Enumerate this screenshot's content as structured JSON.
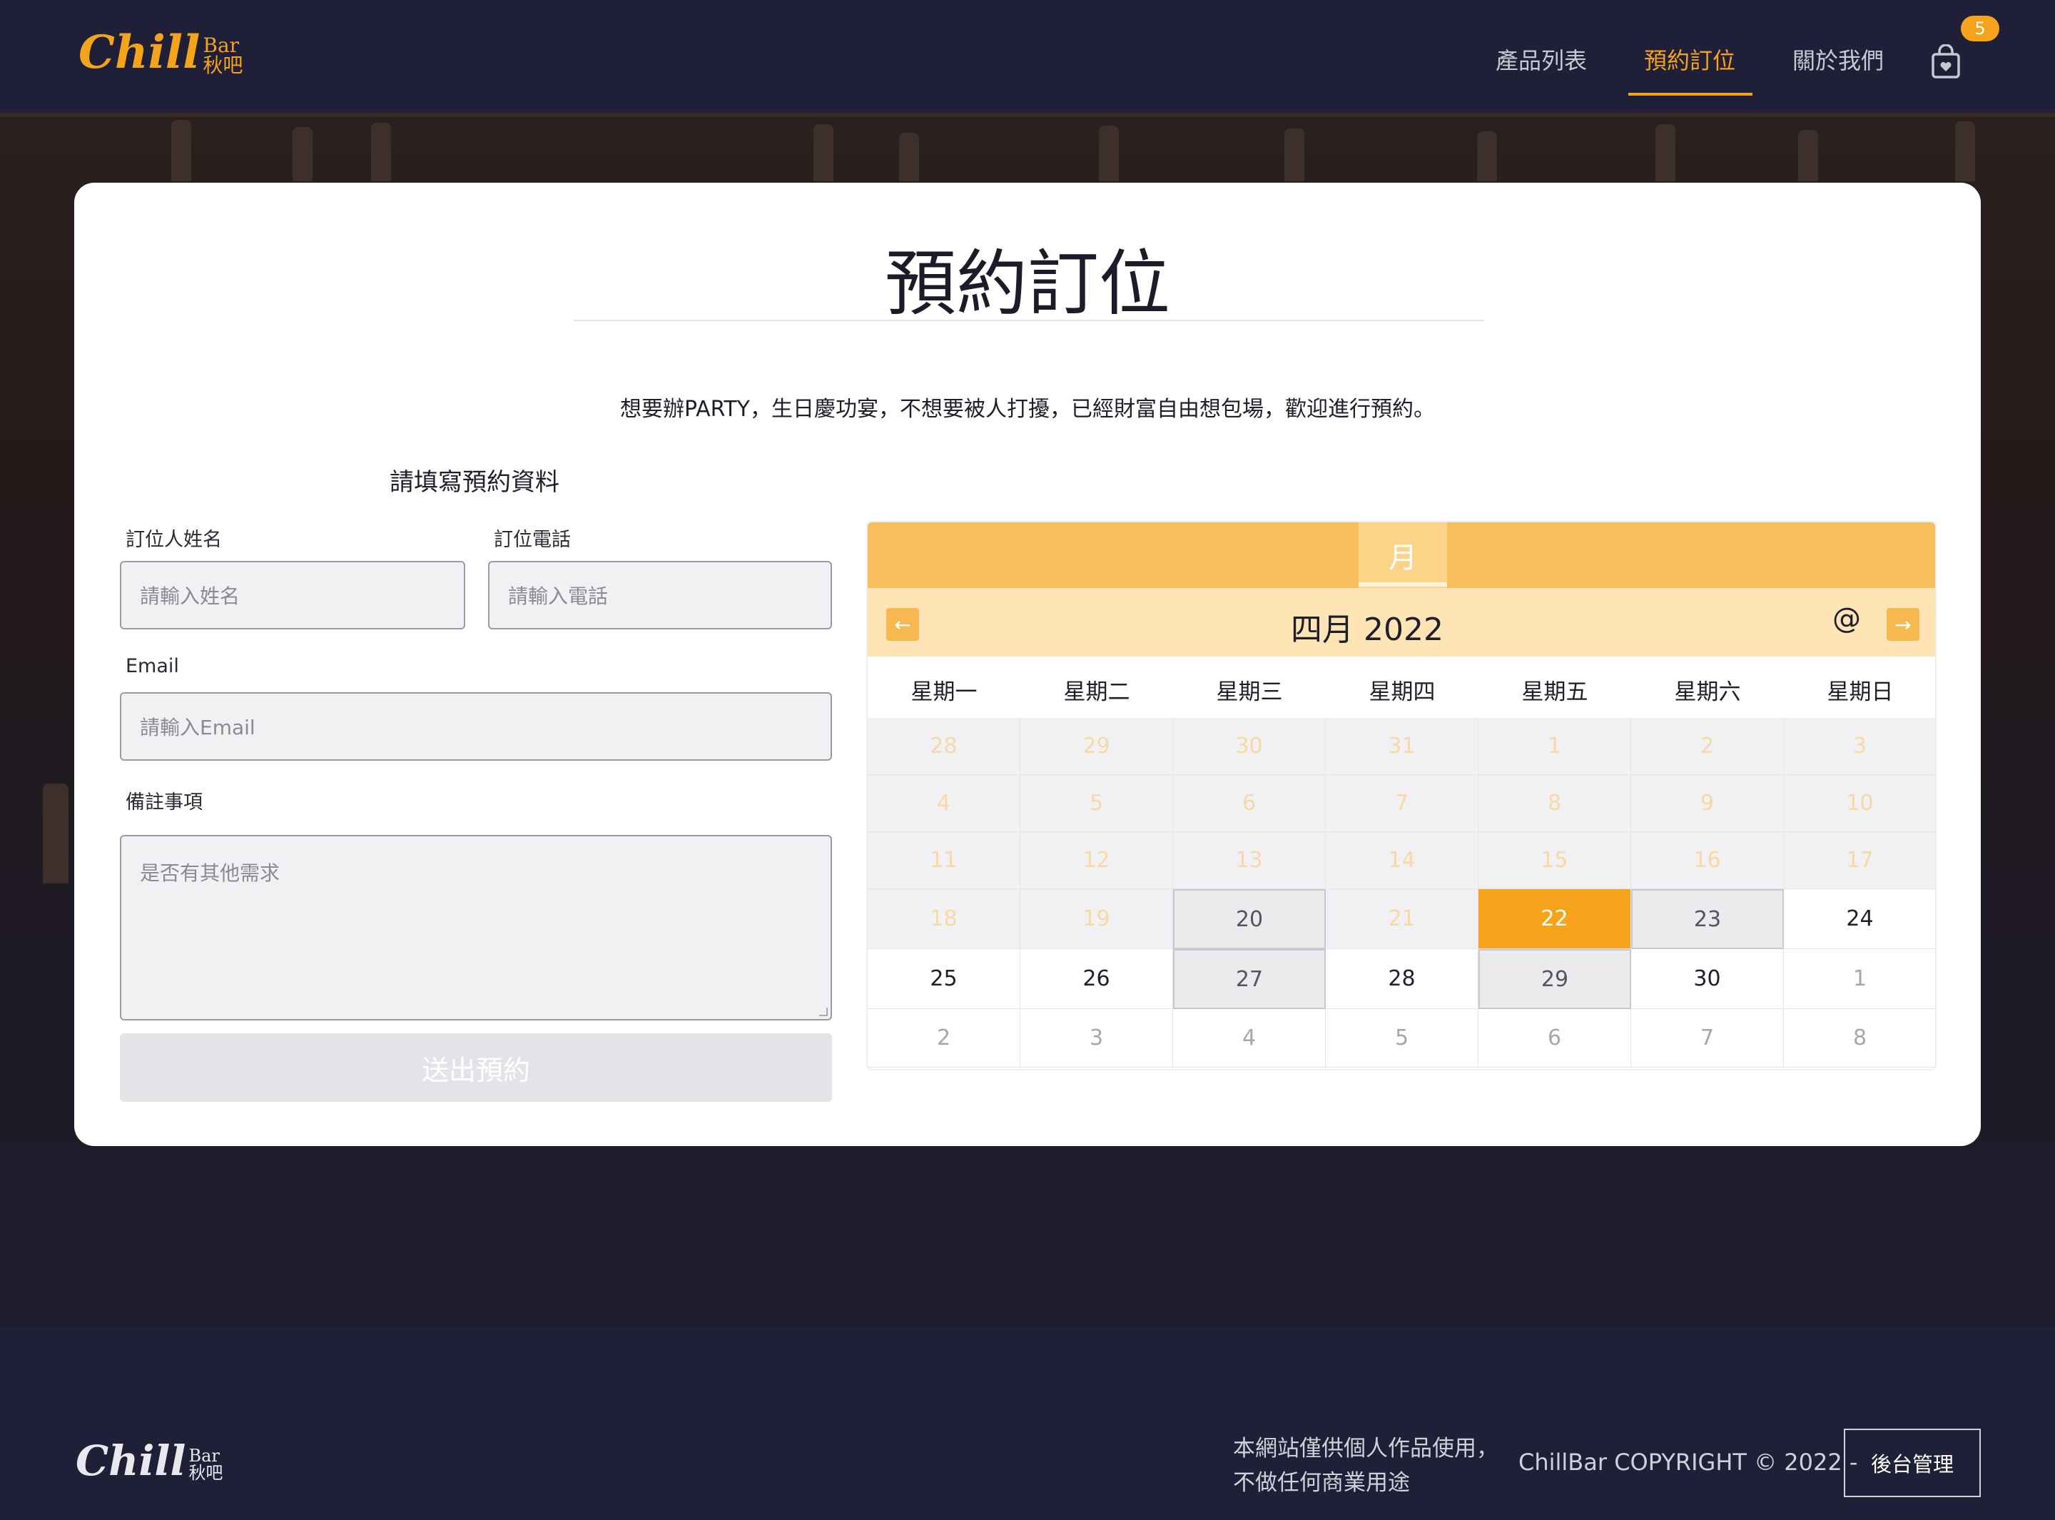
{
  "brand": {
    "main": "Chill",
    "side_top": "Bar",
    "side_bottom": "秋吧"
  },
  "nav": {
    "items": [
      {
        "label": "產品列表"
      },
      {
        "label": "預約訂位"
      },
      {
        "label": "關於我們"
      }
    ],
    "active": "預約訂位",
    "cart_count": "5",
    "cart_icon": "shopping-bag-heart-icon"
  },
  "page": {
    "title": "預約訂位",
    "intro": "想要辦PARTY，生日慶功宴，不想要被人打擾，已經財富自由想包場，歡迎進行預約。"
  },
  "form": {
    "heading": "請填寫預約資料",
    "name_label": "訂位人姓名",
    "name_placeholder": "請輸入姓名",
    "phone_label": "訂位電話",
    "phone_placeholder": "請輸入電話",
    "email_label": "Email",
    "email_placeholder": "請輸入Email",
    "note_label": "備註事項",
    "note_placeholder": "是否有其他需求",
    "submit_label": "送出預約"
  },
  "calendar": {
    "view_tab": "月",
    "month_label": "四月 2022",
    "today_button": "@",
    "prev_icon": "arrow-left-icon",
    "next_icon": "arrow-right-icon",
    "weekdays": [
      "星期一",
      "星期二",
      "星期三",
      "星期四",
      "星期五",
      "星期六",
      "星期日"
    ],
    "weeks": [
      [
        {
          "d": "28",
          "s": "past"
        },
        {
          "d": "29",
          "s": "past"
        },
        {
          "d": "30",
          "s": "past"
        },
        {
          "d": "31",
          "s": "past"
        },
        {
          "d": "1",
          "s": "past"
        },
        {
          "d": "2",
          "s": "past"
        },
        {
          "d": "3",
          "s": "past"
        }
      ],
      [
        {
          "d": "4",
          "s": "past"
        },
        {
          "d": "5",
          "s": "past"
        },
        {
          "d": "6",
          "s": "past"
        },
        {
          "d": "7",
          "s": "past"
        },
        {
          "d": "8",
          "s": "past"
        },
        {
          "d": "9",
          "s": "past"
        },
        {
          "d": "10",
          "s": "past"
        }
      ],
      [
        {
          "d": "11",
          "s": "past"
        },
        {
          "d": "12",
          "s": "past"
        },
        {
          "d": "13",
          "s": "past"
        },
        {
          "d": "14",
          "s": "past"
        },
        {
          "d": "15",
          "s": "past"
        },
        {
          "d": "16",
          "s": "past"
        },
        {
          "d": "17",
          "s": "past"
        }
      ],
      [
        {
          "d": "18",
          "s": "past"
        },
        {
          "d": "19",
          "s": "past"
        },
        {
          "d": "20",
          "s": "closed"
        },
        {
          "d": "21",
          "s": "past"
        },
        {
          "d": "22",
          "s": "selected"
        },
        {
          "d": "23",
          "s": "closed"
        },
        {
          "d": "24",
          "s": "future"
        }
      ],
      [
        {
          "d": "25",
          "s": "future"
        },
        {
          "d": "26",
          "s": "future"
        },
        {
          "d": "27",
          "s": "closed"
        },
        {
          "d": "28",
          "s": "future"
        },
        {
          "d": "29",
          "s": "closed"
        },
        {
          "d": "30",
          "s": "future"
        },
        {
          "d": "1",
          "s": "muted"
        }
      ],
      [
        {
          "d": "2",
          "s": "muted"
        },
        {
          "d": "3",
          "s": "muted"
        },
        {
          "d": "4",
          "s": "muted"
        },
        {
          "d": "5",
          "s": "muted"
        },
        {
          "d": "6",
          "s": "muted"
        },
        {
          "d": "7",
          "s": "muted"
        },
        {
          "d": "8",
          "s": "muted"
        }
      ]
    ]
  },
  "footer": {
    "note_line1": "本網站僅供個人作品使用，",
    "note_line2": "不做任何商業用途",
    "copyright": "ChillBar COPYRIGHT © 2022  -",
    "admin_button": "後台管理"
  },
  "colors": {
    "accent": "#f4a31b",
    "header_bg": "#1f1f38",
    "calendar_header": "#f7bf5e"
  }
}
